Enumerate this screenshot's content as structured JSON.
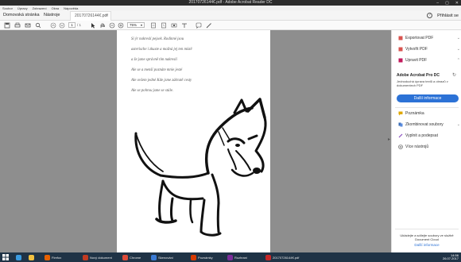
{
  "window": {
    "title": "20170726144€.pdf - Adobe Acrobat Reader DC"
  },
  "menubar": {
    "items": [
      "Soubor",
      "Úpravy",
      "Zobrazení",
      "Okna",
      "Nápověda"
    ]
  },
  "tabs": {
    "home": "Domovská stránka",
    "tools": "Nástroje",
    "document": "20170726144€.pdf",
    "close": "×",
    "signin": "Přihlásit se",
    "help": "?"
  },
  "toolbar": {
    "page_current": "1",
    "page_total": "/ 1",
    "zoom": "75%"
  },
  "document": {
    "handwriting": [
      "Si    ýr    nakreslí  pejsek.  Rodinné  jsou",
      "asterische   i   zkuste   a   možná   jej ten   místě",
      "a   že   jsme   správně   tím   nakreslí",
      "Ale   se   a   menší   poznáte   mnie   jesté",
      "Ale   ovšem   jedné   Kde   jsme   zákrutě   cesty",
      "Ale   se   pohrou   jsme  se  stále."
    ]
  },
  "rightpane": {
    "items": [
      {
        "label": "Exportovat PDF",
        "icon": "export-pdf-icon",
        "color": "#d9534f"
      },
      {
        "label": "Vytvořit PDF",
        "icon": "create-pdf-icon",
        "color": "#d9534f"
      },
      {
        "label": "Upravit PDF",
        "icon": "edit-pdf-icon",
        "color": "#c2185b"
      }
    ],
    "pro_title": "Adobe Acrobat Pro DC",
    "pro_desc": "Jednoduchá úprava textů a obrazů v dokumentech PDF",
    "pro_button": "Další informace",
    "tools": [
      {
        "label": "Poznámka",
        "icon": "comment-icon",
        "color": "#e0a800"
      },
      {
        "label": "Zkombinovat soubory",
        "icon": "combine-files-icon",
        "color": "#3b6cb5"
      },
      {
        "label": "Vyplnit a podepsat",
        "icon": "fill-sign-icon",
        "color": "#8a4fbf"
      },
      {
        "label": "Více nástrojů",
        "icon": "more-tools-icon",
        "color": "#555555"
      }
    ],
    "footer_text": "Ukládejte a sdílejte soubory ve službě Document Cloud",
    "footer_link": "Další informace"
  },
  "taskbar": {
    "apps": [
      {
        "label": "Firefox",
        "color": "#e66000"
      },
      {
        "label": "Nový dokument",
        "color": "#c23b22"
      },
      {
        "label": "Chrome",
        "color": "#dd4b39"
      },
      {
        "label": "Skenování",
        "color": "#3a7bd5"
      },
      {
        "label": "Poznámky",
        "color": "#d83b01"
      },
      {
        "label": "Rozhraní",
        "color": "#7b2d9b"
      },
      {
        "label": "20170726144€.pdf",
        "color": "#c62828"
      }
    ],
    "time": "14:56",
    "date": "26.07.2017"
  }
}
